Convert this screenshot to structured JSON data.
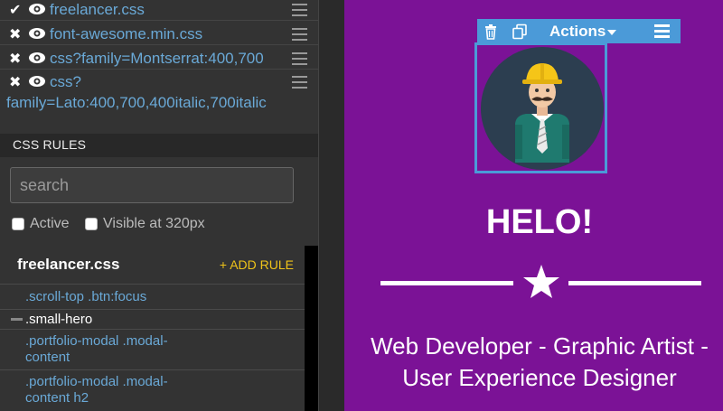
{
  "stylesheets": [
    {
      "state": "✔",
      "name": "freelancer.css",
      "name_line2": ""
    },
    {
      "state": "✖",
      "name": "font-awesome.min.css",
      "name_line2": ""
    },
    {
      "state": "✖",
      "name": "css?family=Montserrat:400,700",
      "name_line2": ""
    },
    {
      "state": "✖",
      "name": "css?",
      "name_line2": "family=Lato:400,700,400italic,700italic"
    }
  ],
  "css_rules": {
    "header": "CSS RULES",
    "search_placeholder": "search",
    "filters": [
      "Active",
      "Visible at 320px"
    ],
    "file_name": "freelancer.css",
    "add_rule_label": "+ ADD RULE",
    "rules": [
      {
        "line1": ".scroll-top .btn:focus",
        "line2": ""
      },
      {
        "line1": ".small-hero",
        "line2": "",
        "active": true
      },
      {
        "line1": ".portfolio-modal .modal-",
        "line2": "content"
      },
      {
        "line1": ".portfolio-modal .modal-",
        "line2": "content h2"
      }
    ]
  },
  "preview": {
    "toolbar": {
      "actions_label": "Actions",
      "icons": [
        "trash-icon",
        "copy-icon",
        "caret-down-icon",
        "hamburger-menu-icon"
      ]
    },
    "hero_title": "HELO!",
    "subtitle_line1": "Web Developer - Graphic Artist -",
    "subtitle_line2": "User Experience Designer",
    "colors": {
      "background": "#7b1296",
      "accent_blue": "#4b9ad8",
      "link_blue": "#6aa9d7",
      "add_rule_yellow": "#f0c419"
    }
  }
}
